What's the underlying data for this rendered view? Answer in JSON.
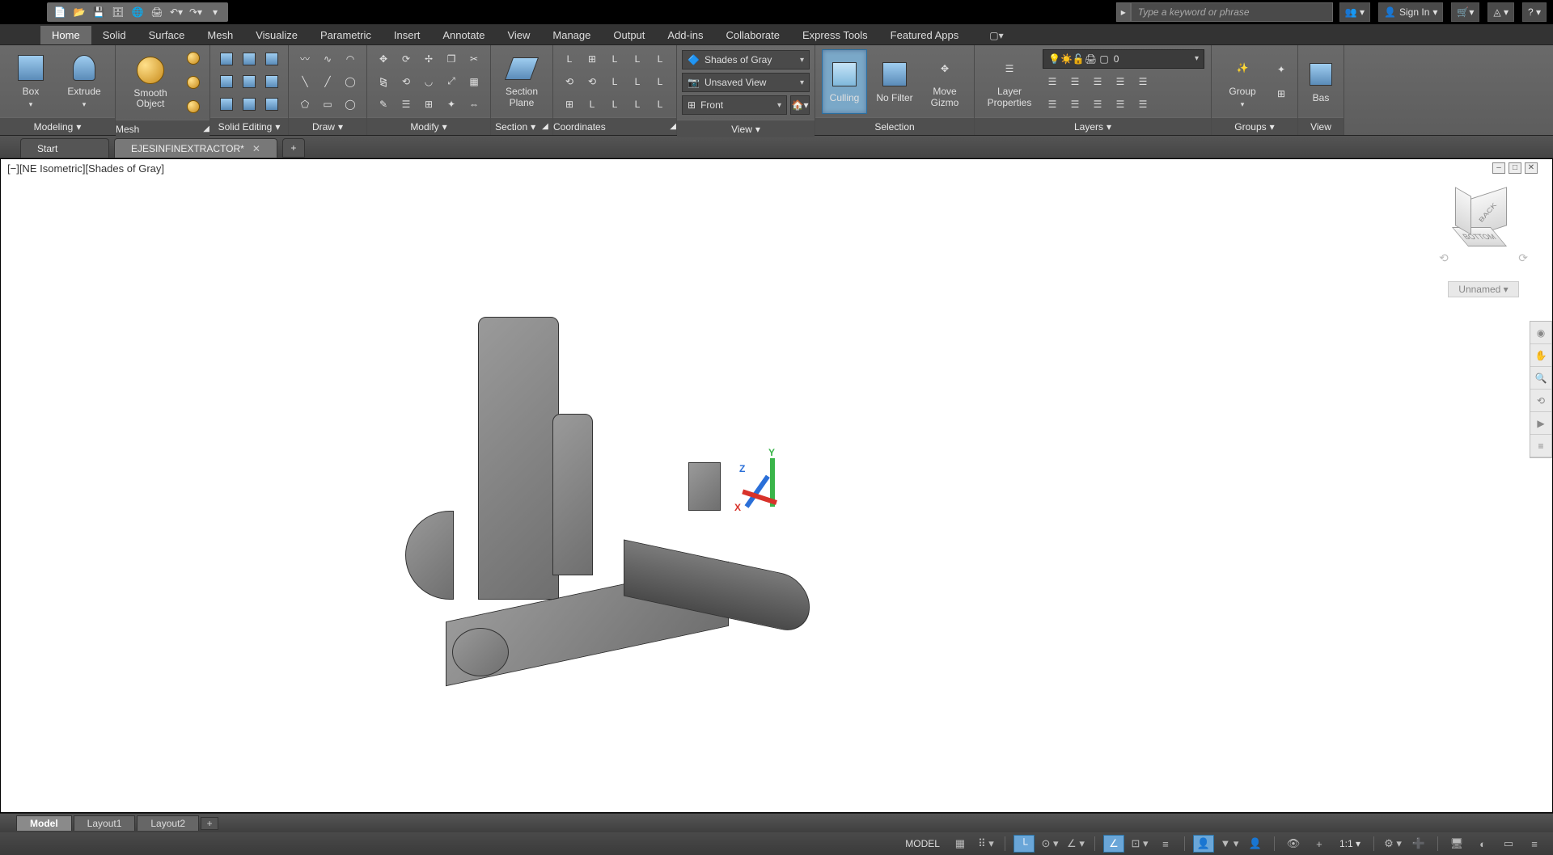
{
  "titlebar": {
    "search_placeholder": "Type a keyword or phrase",
    "sign_in": "Sign In"
  },
  "ribbon_tabs": [
    "Home",
    "Solid",
    "Surface",
    "Mesh",
    "Visualize",
    "Parametric",
    "Insert",
    "Annotate",
    "View",
    "Manage",
    "Output",
    "Add-ins",
    "Collaborate",
    "Express Tools",
    "Featured Apps"
  ],
  "active_ribbon_tab": "Home",
  "panels": {
    "modeling": {
      "title": "Modeling",
      "box": "Box",
      "extrude": "Extrude"
    },
    "mesh": {
      "title": "Mesh",
      "smooth": "Smooth Object"
    },
    "solid_editing": {
      "title": "Solid Editing"
    },
    "draw": {
      "title": "Draw"
    },
    "modify": {
      "title": "Modify"
    },
    "section": {
      "title": "Section",
      "plane": "Section Plane"
    },
    "coordinates": {
      "title": "Coordinates"
    },
    "view": {
      "title": "View",
      "visual_style": "Shades of Gray",
      "saved_view": "Unsaved View",
      "front": "Front"
    },
    "selection": {
      "title": "Selection",
      "culling": "Culling",
      "nofilter": "No Filter",
      "movegizmo": "Move Gizmo"
    },
    "layers": {
      "title": "Layers",
      "props": "Layer Properties",
      "current": "0"
    },
    "groups": {
      "title": "Groups",
      "group": "Group"
    },
    "view2": {
      "title": "View",
      "base": "Bas"
    }
  },
  "file_tabs": {
    "start": "Start",
    "active": "EJESINFINEXTRACTOR*"
  },
  "viewport": {
    "label": "[−][NE Isometric][Shades of Gray]",
    "cube_face_back": "BACK",
    "cube_face_bottom": "BOTTOM",
    "unnamed": "Unnamed",
    "axis": {
      "x": "X",
      "y": "Y",
      "z": "Z"
    }
  },
  "layout_tabs": [
    "Model",
    "Layout1",
    "Layout2"
  ],
  "active_layout_tab": "Model",
  "statusbar": {
    "model": "MODEL",
    "scale": "1:1"
  }
}
